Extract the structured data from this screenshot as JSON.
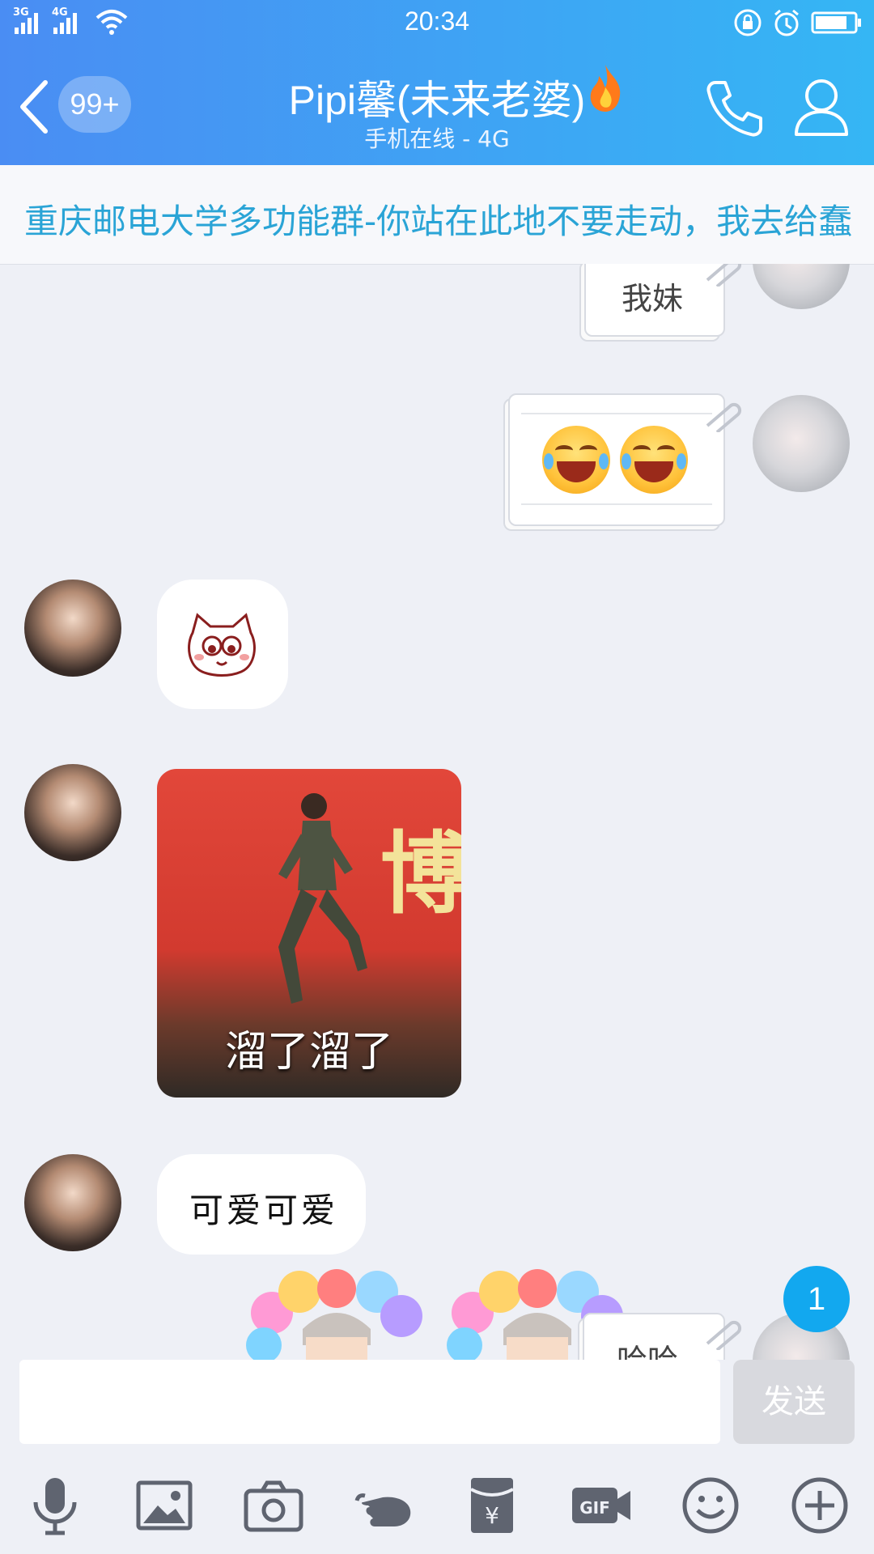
{
  "status_bar": {
    "signal1": "3G",
    "signal2": "4G",
    "time": "20:34"
  },
  "header": {
    "unread_count": "99+",
    "title": "Pipi馨(未来老婆)",
    "subtitle": "手机在线 - 4G"
  },
  "notice": {
    "text": "重庆邮电大学多功能群-你站在此地不要走动，我去给蠢"
  },
  "messages": {
    "m1_text": "我妹",
    "m3_text": "",
    "m4_caption": "溜了溜了",
    "m5_text": "可爱可爱",
    "m6_text": "哈哈"
  },
  "photo_sign_char": "博",
  "unread_badge": "1",
  "input": {
    "placeholder": "",
    "send_label": "发送"
  },
  "toolbar": [
    "mic-icon",
    "image-icon",
    "camera-icon",
    "poke-icon",
    "red-packet-icon",
    "gif-icon",
    "emoji-icon",
    "plus-icon"
  ],
  "colors": {
    "header_start": "#4a8df3",
    "header_end": "#35b6f4",
    "notice_text": "#2aa4d6",
    "badge": "#12a8ef"
  }
}
